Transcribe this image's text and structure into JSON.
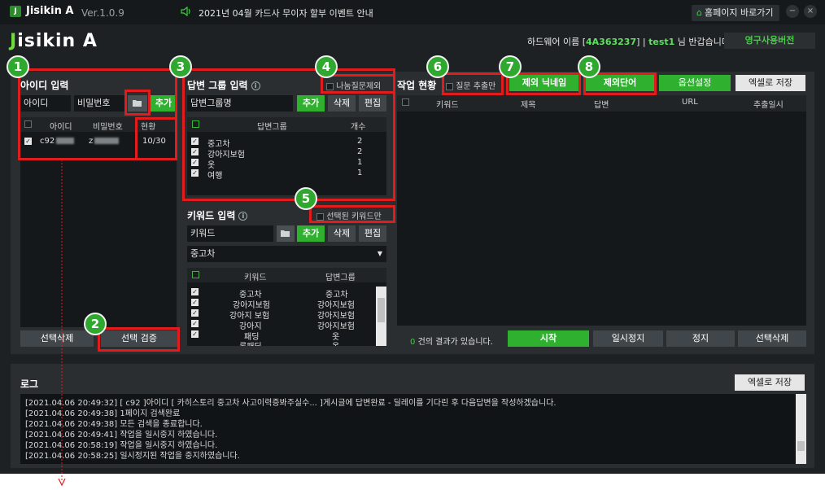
{
  "titlebar": {
    "logo_letter": "J",
    "app_name": "Jisikin A",
    "version": "Ver.1.0.9",
    "notice": "2021년 04월 카드사 무이자 할부 이벤트 안내",
    "home_button": "홈페이지 바로가기",
    "minimize": "−",
    "close": "×"
  },
  "header": {
    "brand_j": "J",
    "brand_rest": "isikin A",
    "hw_label": "하드웨어 이름 [",
    "hw_id": "4A363237",
    "hw_sep": "] |",
    "user": "test1",
    "greet": "님 반갑습니다!",
    "permanent_button": "영구사용버전"
  },
  "account_panel": {
    "title": "아이디 입력",
    "id_value": "아이디",
    "pw_value": "비밀번호",
    "add_button": "추가",
    "columns": [
      "아이디",
      "비밀번호",
      "현황"
    ],
    "rows": [
      {
        "id": "c92",
        "pw": "z",
        "status": "10/30"
      }
    ],
    "delete_selected": "선택삭제",
    "verify_selected": "선택 검증"
  },
  "answer_panel": {
    "title": "답변 그룹 입력",
    "exclude_label": "나눔질문제외",
    "input_value": "답변그룹명",
    "add_button": "추가",
    "delete_button": "삭제",
    "edit_button": "편집",
    "columns": [
      "답변그룹",
      "개수"
    ],
    "rows": [
      {
        "name": "중고차",
        "count": "2"
      },
      {
        "name": "강아지보험",
        "count": "2"
      },
      {
        "name": "옷",
        "count": "1"
      },
      {
        "name": "여행",
        "count": "1"
      }
    ],
    "selected_keyword_only": "선택된 키워드만"
  },
  "keyword_panel": {
    "title": "키워드 입력",
    "input_value": "키워드",
    "add_button": "추가",
    "delete_button": "삭제",
    "edit_button": "편집",
    "dropdown_value": "중고차",
    "columns": [
      "키워드",
      "답변그룹"
    ],
    "rows": [
      {
        "keyword": "중고차",
        "group": "중고차"
      },
      {
        "keyword": "강아지보험",
        "group": "강아지보험"
      },
      {
        "keyword": "강아지 보험",
        "group": "강아지보험"
      },
      {
        "keyword": "강아지",
        "group": "강아지보험"
      },
      {
        "keyword": "패딩",
        "group": "옷"
      },
      {
        "keyword": "롱패딩",
        "group": "옷"
      }
    ]
  },
  "work_panel": {
    "title": "작업 현황",
    "question_extract_only": "질문 추출만",
    "exclude_nickname": "제외 닉네임",
    "exclude_words": "제외단어",
    "options": "옵션설정",
    "excel_save": "엑셀로 저장",
    "columns": [
      "키워드",
      "제목",
      "답변",
      "URL",
      "추출일시"
    ],
    "result_count": "0",
    "result_text": "건의 결과가 있습니다.",
    "start": "시작",
    "pause": "일시정지",
    "stop": "정지",
    "delete_selected": "선택삭제"
  },
  "log_panel": {
    "title": "로그",
    "excel_save": "엑셀로 저장",
    "lines": [
      "[2021.04.06 20:49:32]   [ c92     ]아이디 [ 카히스토리 중고차 사고이력증봐주실수... ]게시글에 답변완료 - 딜레이를 기다린 후 다음답변을 작성하겠습니다.",
      "[2021.04.06 20:49:38]   1페이지 검색완료",
      "[2021.04.06 20:49:38]   모든 검색을 종료합니다.",
      "[2021.04.06 20:49:41]   작업을 일시중지 하였습니다.",
      "[2021.04.06 20:58:19]   작업을 일시중지 하였습니다.",
      "[2021.04.06 20:58:25]   일시정지된 작업을 중지하였습니다."
    ]
  },
  "callouts": [
    "1",
    "2",
    "3",
    "4",
    "5",
    "6",
    "7",
    "8"
  ],
  "colors": {
    "accent": "#2fb02f",
    "highlight": "#e11c1c",
    "background": "#1d2124"
  }
}
